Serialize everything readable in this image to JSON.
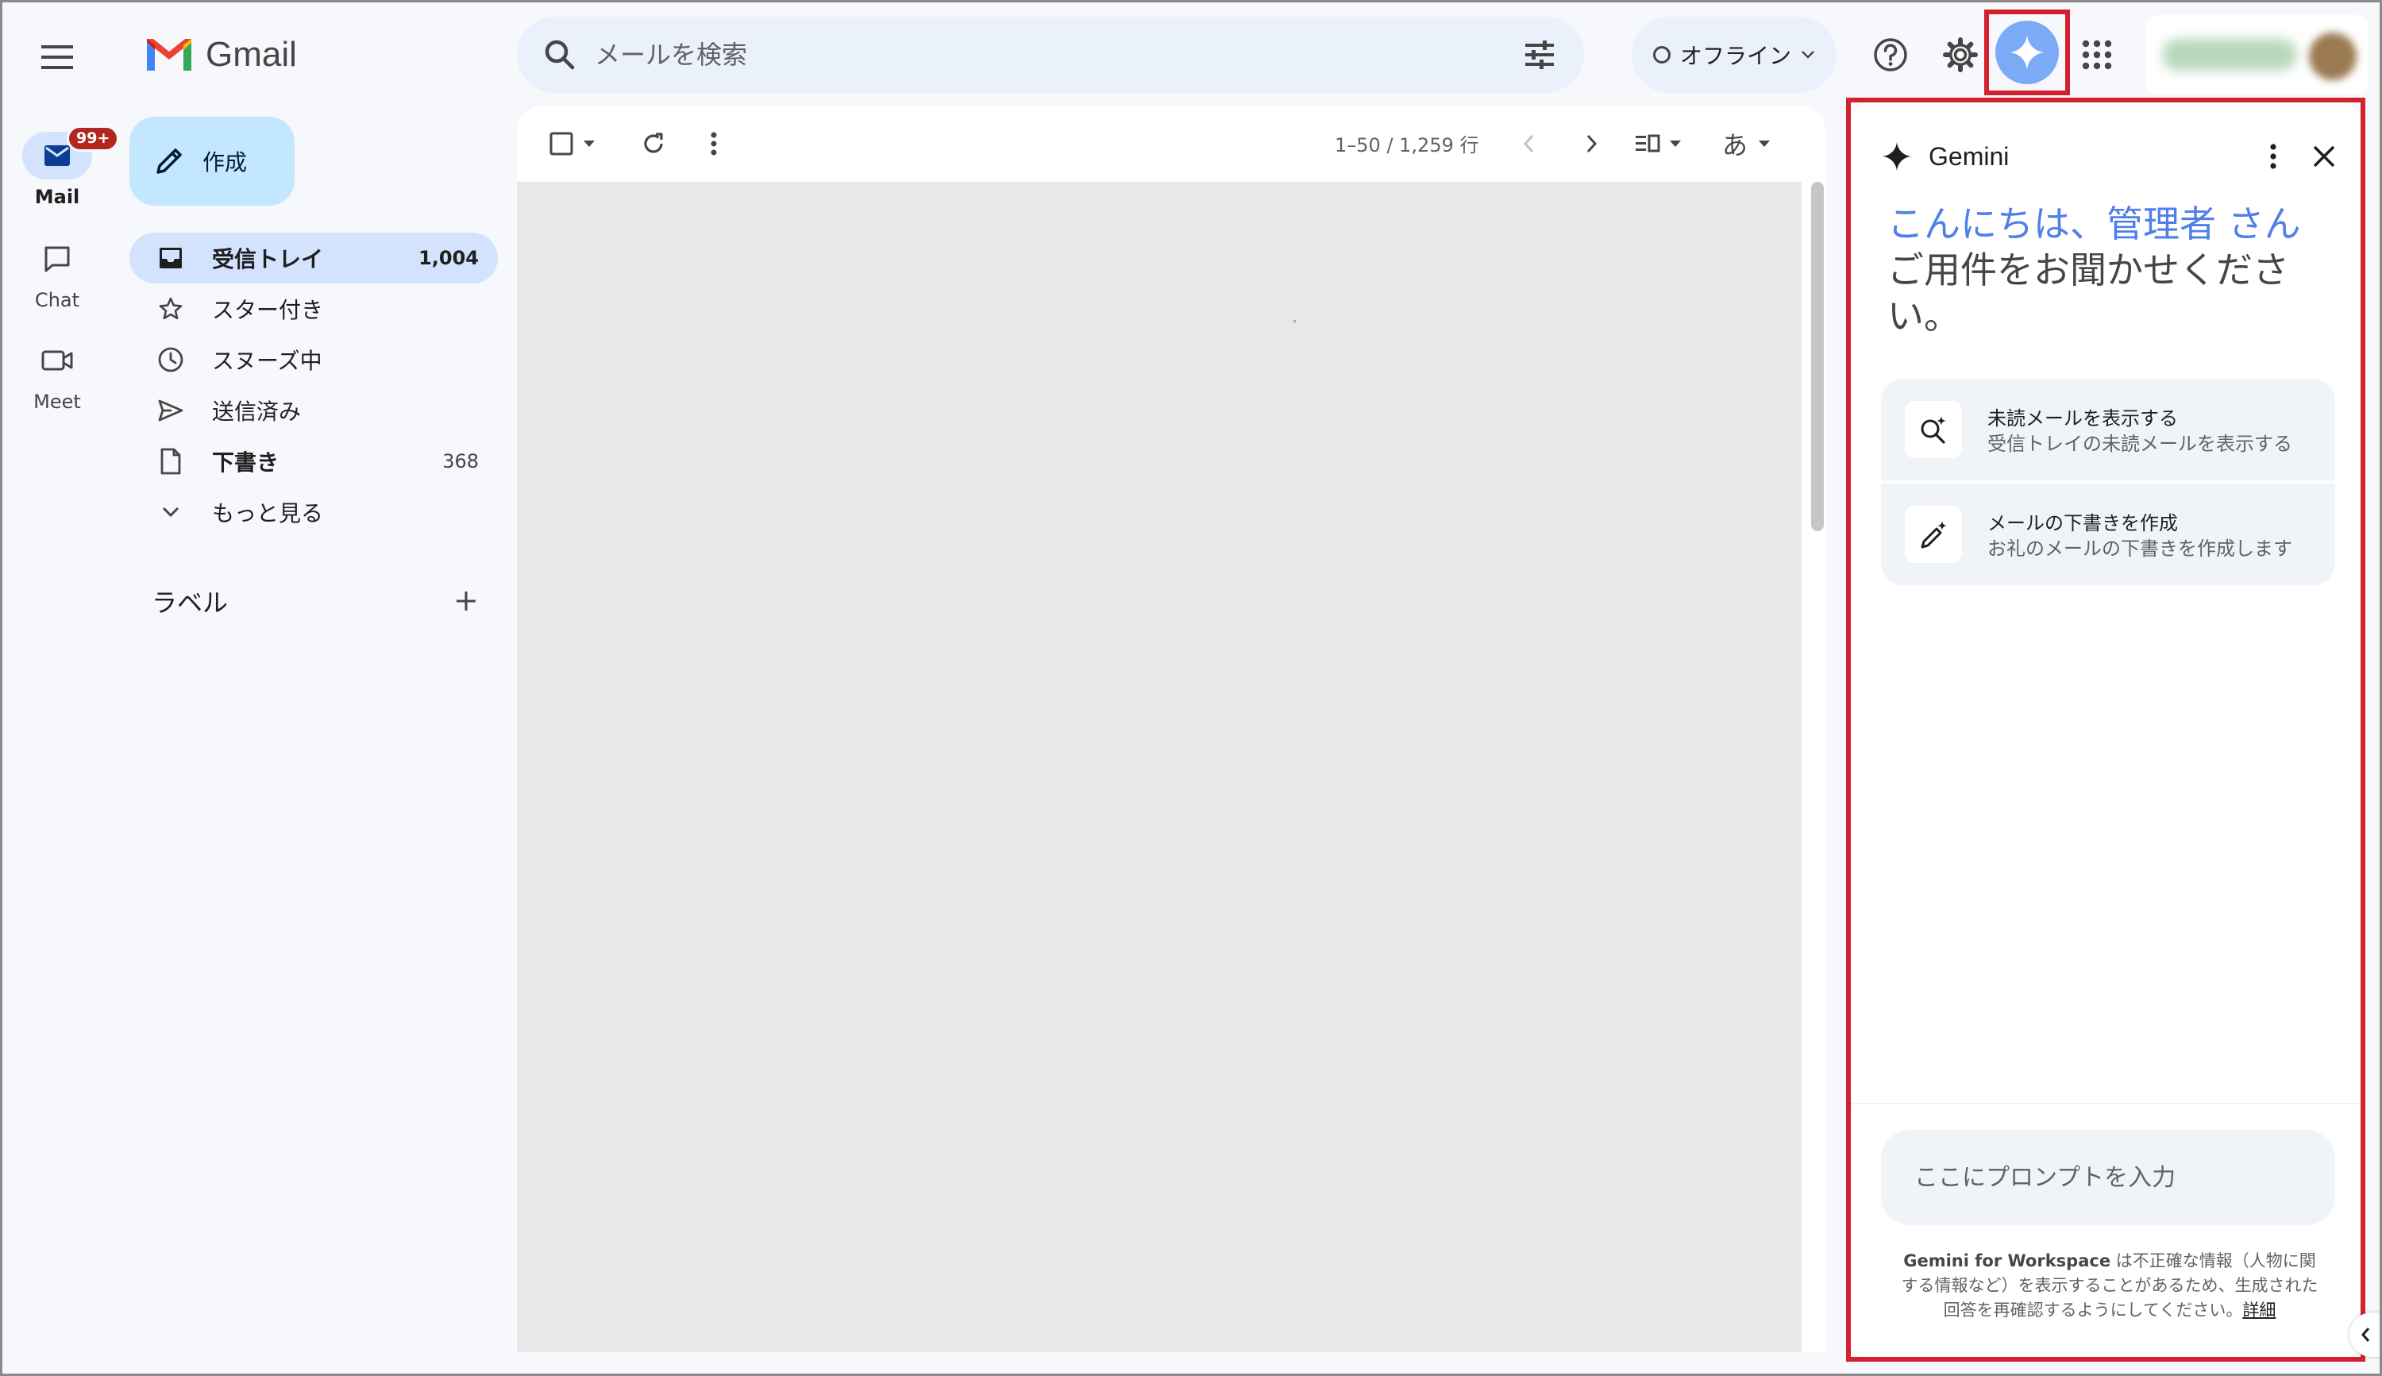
{
  "rail": {
    "items": [
      {
        "label": "Mail",
        "badge": "99+",
        "icon": "mail-icon"
      },
      {
        "label": "Chat",
        "icon": "chat-icon"
      },
      {
        "label": "Meet",
        "icon": "video-icon"
      }
    ]
  },
  "header": {
    "logo_text": "Gmail",
    "search_placeholder": "メールを検索",
    "status_label": "オフライン",
    "icons": [
      "help-icon",
      "settings-icon",
      "gemini-icon",
      "apps-icon"
    ]
  },
  "sidebar": {
    "compose_label": "作成",
    "items": [
      {
        "label": "受信トレイ",
        "count": "1,004",
        "icon": "inbox-icon"
      },
      {
        "label": "スター付き",
        "count": "",
        "icon": "star-icon"
      },
      {
        "label": "スヌーズ中",
        "count": "",
        "icon": "clock-icon"
      },
      {
        "label": "送信済み",
        "count": "",
        "icon": "send-icon"
      },
      {
        "label": "下書き",
        "count": "368",
        "icon": "draft-icon"
      },
      {
        "label": "もっと見る",
        "count": "",
        "icon": "chevron-down-icon"
      }
    ],
    "labels_title": "ラベル"
  },
  "toolbar": {
    "pager": "1–50 / 1,259 行",
    "input_tool_label": "あ"
  },
  "gemini": {
    "title": "Gemini",
    "greeting_hello": "こんにちは、管理者 さん",
    "greeting_sub": "ご用件をお聞かせください。",
    "suggestions": [
      {
        "title": "未読メールを表示する",
        "desc": "受信トレイの未読メールを表示する",
        "icon": "search-sparkle-icon"
      },
      {
        "title": "メールの下書きを作成",
        "desc": "お礼のメールの下書きを作成します",
        "icon": "pen-sparkle-icon"
      }
    ],
    "prompt_placeholder": "ここにプロンプトを入力",
    "disclaimer_strong": "Gemini for Workspace",
    "disclaimer_text": " は不正確な情報（人物に関する情報など）を表示することがあるため、生成された回答を再確認するようにしてください。",
    "disclaimer_link": "詳細"
  },
  "colors": {
    "accent": "#0b57d0",
    "active_bg": "#d3e3fd",
    "compose_bg": "#c2e7ff",
    "highlight_outline": "#d4212e",
    "greeting": "#4f7fe8",
    "badge": "#b3261e"
  }
}
